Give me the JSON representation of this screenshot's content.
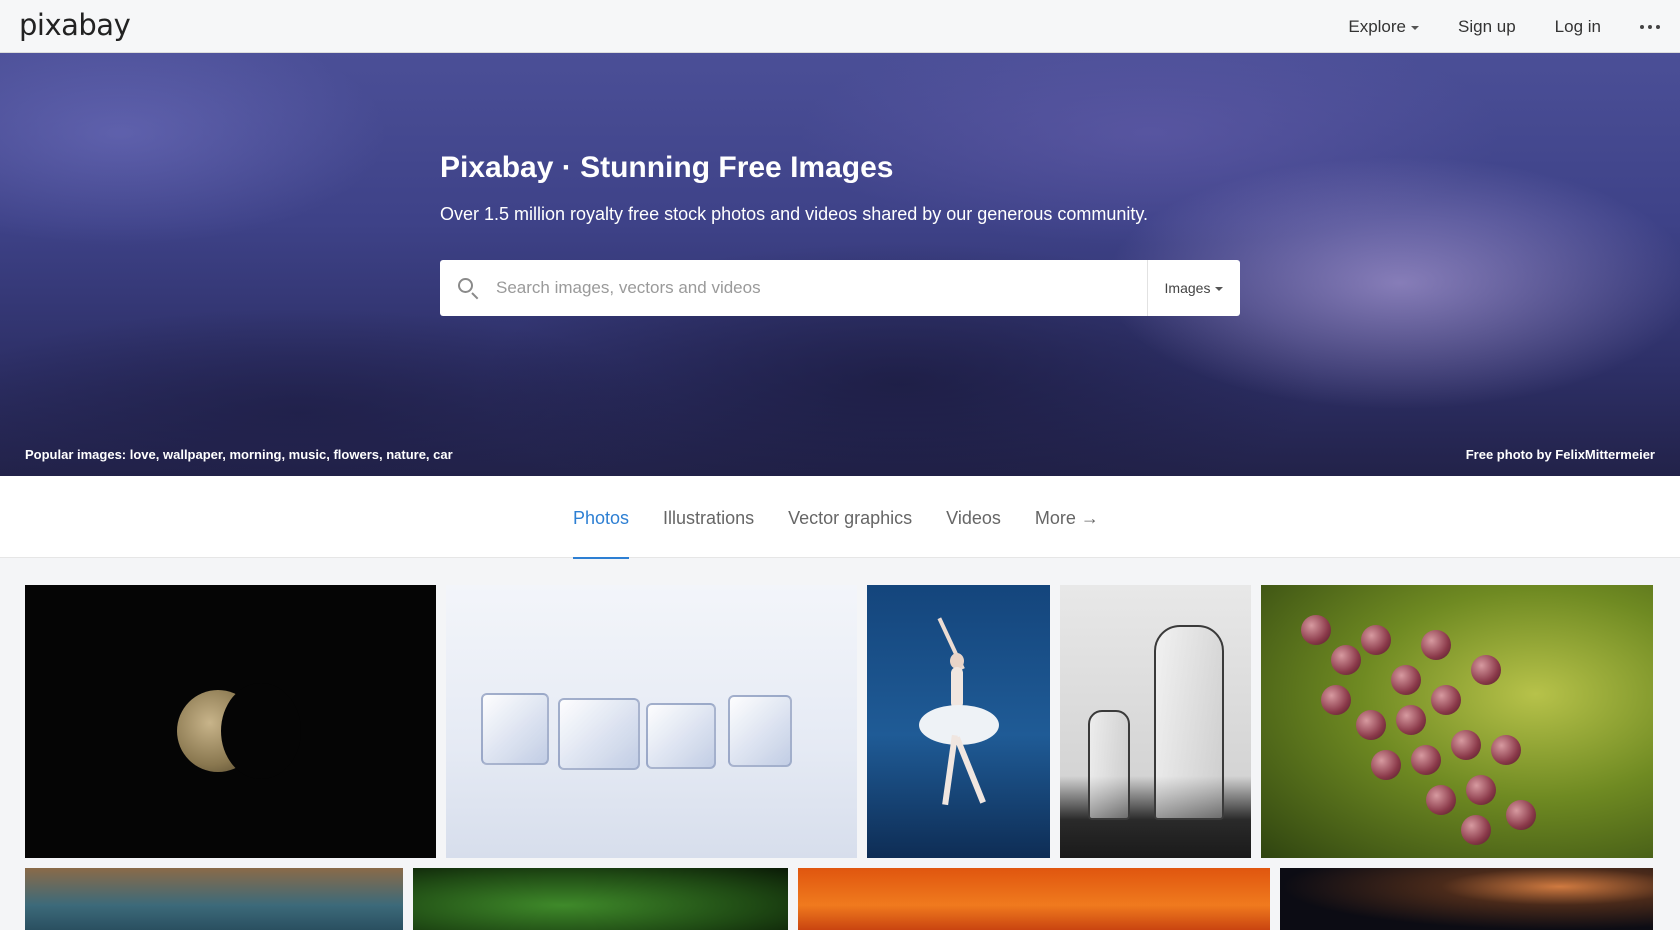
{
  "header": {
    "logo": "pixabay",
    "nav": {
      "explore": "Explore",
      "signup": "Sign up",
      "login": "Log in"
    },
    "more_icon": "more-dots-icon"
  },
  "hero": {
    "title": "Pixabay · Stunning Free Images",
    "subtitle": "Over 1.5 million royalty free stock photos and videos shared by our generous community.",
    "search": {
      "placeholder": "Search images, vectors and videos",
      "value": "",
      "type_label": "Images",
      "icon": "search-icon"
    },
    "popular": "Popular images: love, wallpaper, morning, music, flowers, nature, car",
    "credit": "Free photo by FelixMittermeier",
    "colors": {
      "sky_top": "#4b4f97",
      "sky_bottom": "#222249"
    }
  },
  "tabs": {
    "items": [
      {
        "label": "Photos",
        "active": true
      },
      {
        "label": "Illustrations",
        "active": false
      },
      {
        "label": "Vector graphics",
        "active": false
      },
      {
        "label": "Videos",
        "active": false
      },
      {
        "label": "More →",
        "active": false
      }
    ],
    "active_color": "#2d7fd3"
  },
  "gallery": {
    "tiles": [
      {
        "name": "moon"
      },
      {
        "name": "ice-cubes"
      },
      {
        "name": "ballet-dancer"
      },
      {
        "name": "bottles"
      },
      {
        "name": "grapes"
      },
      {
        "name": "building"
      },
      {
        "name": "basil"
      },
      {
        "name": "sunset-sky"
      },
      {
        "name": "bokeh-lights"
      }
    ]
  }
}
